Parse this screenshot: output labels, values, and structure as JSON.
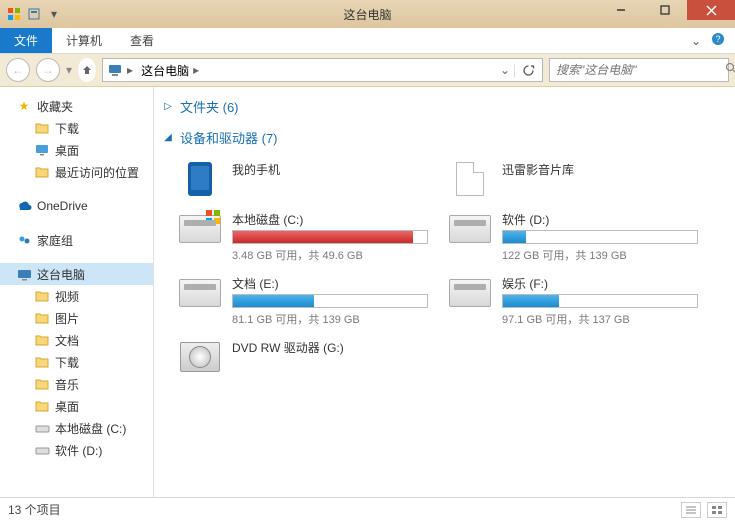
{
  "window": {
    "title": "这台电脑"
  },
  "ribbon": {
    "file": "文件",
    "computer": "计算机",
    "view": "查看"
  },
  "address": {
    "root": "这台电脑"
  },
  "search": {
    "placeholder": "搜索\"这台电脑\""
  },
  "sidebar": {
    "favorites": "收藏夹",
    "downloads": "下载",
    "desktop": "桌面",
    "recent": "最近访问的位置",
    "onedrive": "OneDrive",
    "homegroup": "家庭组",
    "thispc": "这台电脑",
    "videos": "视频",
    "pictures": "图片",
    "documents": "文档",
    "downloads2": "下载",
    "music": "音乐",
    "desktop2": "桌面",
    "driveC": "本地磁盘 (C:)",
    "driveD": "软件 (D:)"
  },
  "groups": {
    "folders": "文件夹 (6)",
    "devices": "设备和驱动器 (7)"
  },
  "devices": [
    {
      "name": "我的手机",
      "type": "phone"
    },
    {
      "name": "迅雷影音片库",
      "type": "file"
    },
    {
      "name": "本地磁盘 (C:)",
      "type": "drive",
      "color": "red",
      "pct": 93,
      "info": "3.48 GB 可用，共 49.6 GB",
      "flag": true
    },
    {
      "name": "软件 (D:)",
      "type": "drive",
      "color": "blue",
      "pct": 12,
      "info": "122 GB 可用，共 139 GB"
    },
    {
      "name": "文档 (E:)",
      "type": "drive",
      "color": "blue",
      "pct": 42,
      "info": "81.1 GB 可用，共 139 GB"
    },
    {
      "name": "娱乐 (F:)",
      "type": "drive",
      "color": "blue",
      "pct": 29,
      "info": "97.1 GB 可用，共 137 GB"
    },
    {
      "name": "DVD RW 驱动器 (G:)",
      "type": "dvd"
    }
  ],
  "status": {
    "count": "13 个项目"
  }
}
